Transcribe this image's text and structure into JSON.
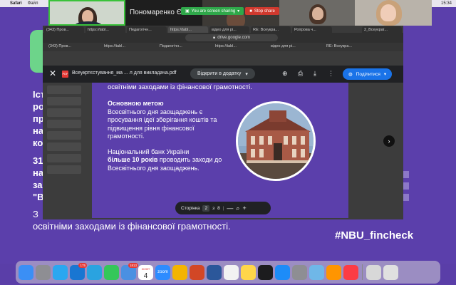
{
  "menubar": {
    "app": "Safari",
    "items": [
      "Файл"
    ],
    "time": "15:34"
  },
  "zoom": {
    "participant_name": "Пономаренко Єлизав...",
    "sharing_label": "You are screen sharing",
    "stop_label": "Stop share"
  },
  "browser": {
    "tabs": [
      "(343) Пров...",
      "https://tabl...",
      "Педагогічн...",
      "https://tabl...",
      "відео для рі...",
      "RE: Всеукра...",
      "Роігрова ч...",
      "2_Всеукраї..."
    ],
    "address": "drive.google.com"
  },
  "viewer": {
    "file_name": "Всеукртєстування_ма ... л для викладача.pdf",
    "open_with_label": "Відкрити в додатку",
    "share_label": "Поділитися"
  },
  "pdf": {
    "top_line": "освітніми заходами із фінансової грамотності.",
    "p1_bold": "Основною метою",
    "p1_text": "Всесвітнього дня заощаджень є просування ідеї зберігання коштів та підвищення рівня фінансової грамотності.",
    "p2_pre": "Національний банк України",
    "p2_bold": "більше 10 років",
    "p2_text": "проводить заходи до Всесвітнього дня заощаджень."
  },
  "page_control": {
    "label": "Сторінка",
    "current": "2",
    "of": "з",
    "total": "8",
    "minus": "—",
    "zoom_icon": "⌕",
    "plus": "+"
  },
  "background": {
    "left_lines": [
      "Іст",
      "ро",
      "пр",
      "на",
      "ко",
      "31",
      "на",
      "за",
      "\"В"
    ],
    "bottom_prefix": "З",
    "bottom_line": "освітніми заходами із фінансової грамотності.",
    "hashtag": "#NBU_fincheck"
  },
  "dock": {
    "apps": [
      {
        "name": "finder-icon",
        "color": "#3b8ff5",
        "badge": ""
      },
      {
        "name": "launchpad-icon",
        "color": "#8e8e93",
        "badge": ""
      },
      {
        "name": "safari-icon",
        "color": "#2aa7f0",
        "badge": ""
      },
      {
        "name": "messenger-icon",
        "color": "#1976d2",
        "badge": "175"
      },
      {
        "name": "telegram-icon",
        "color": "#2aa3e0",
        "badge": ""
      },
      {
        "name": "facetime-icon",
        "color": "#34c759",
        "badge": ""
      },
      {
        "name": "mail-icon",
        "color": "#4a90e2",
        "badge": "1813"
      },
      {
        "name": "calendar-icon",
        "color": "#ffffff",
        "badge": ""
      },
      {
        "name": "zoom-icon",
        "color": "#2d8cff",
        "badge": ""
      },
      {
        "name": "photos-icon",
        "color": "#f4b400",
        "badge": ""
      },
      {
        "name": "powerpoint-icon",
        "color": "#d24726",
        "badge": ""
      },
      {
        "name": "word-icon",
        "color": "#2b579a",
        "badge": ""
      },
      {
        "name": "reminders-icon",
        "color": "#f2f2f2",
        "badge": ""
      },
      {
        "name": "notes-icon",
        "color": "#ffd64a",
        "badge": ""
      },
      {
        "name": "activity-icon",
        "color": "#1c1c1e",
        "badge": ""
      },
      {
        "name": "appstore-icon",
        "color": "#1d8cf8",
        "badge": ""
      },
      {
        "name": "settings-icon",
        "color": "#8e8e93",
        "badge": ""
      },
      {
        "name": "preview-icon",
        "color": "#6fb7e8",
        "badge": ""
      },
      {
        "name": "books-icon",
        "color": "#ff9500",
        "badge": ""
      },
      {
        "name": "music-icon",
        "color": "#fc3c44",
        "badge": ""
      },
      {
        "name": "downloads-icon",
        "color": "#d8d8d8",
        "badge": ""
      },
      {
        "name": "trash-icon",
        "color": "#e0e0e0",
        "badge": ""
      }
    ],
    "calendar_month": "ЖОВТ",
    "calendar_day": "4",
    "zoom_label": "zoom"
  },
  "colors": {
    "slide_purple": "#5b3fab",
    "accent_green": "#6dd48a",
    "share_blue": "#1a73e8"
  }
}
